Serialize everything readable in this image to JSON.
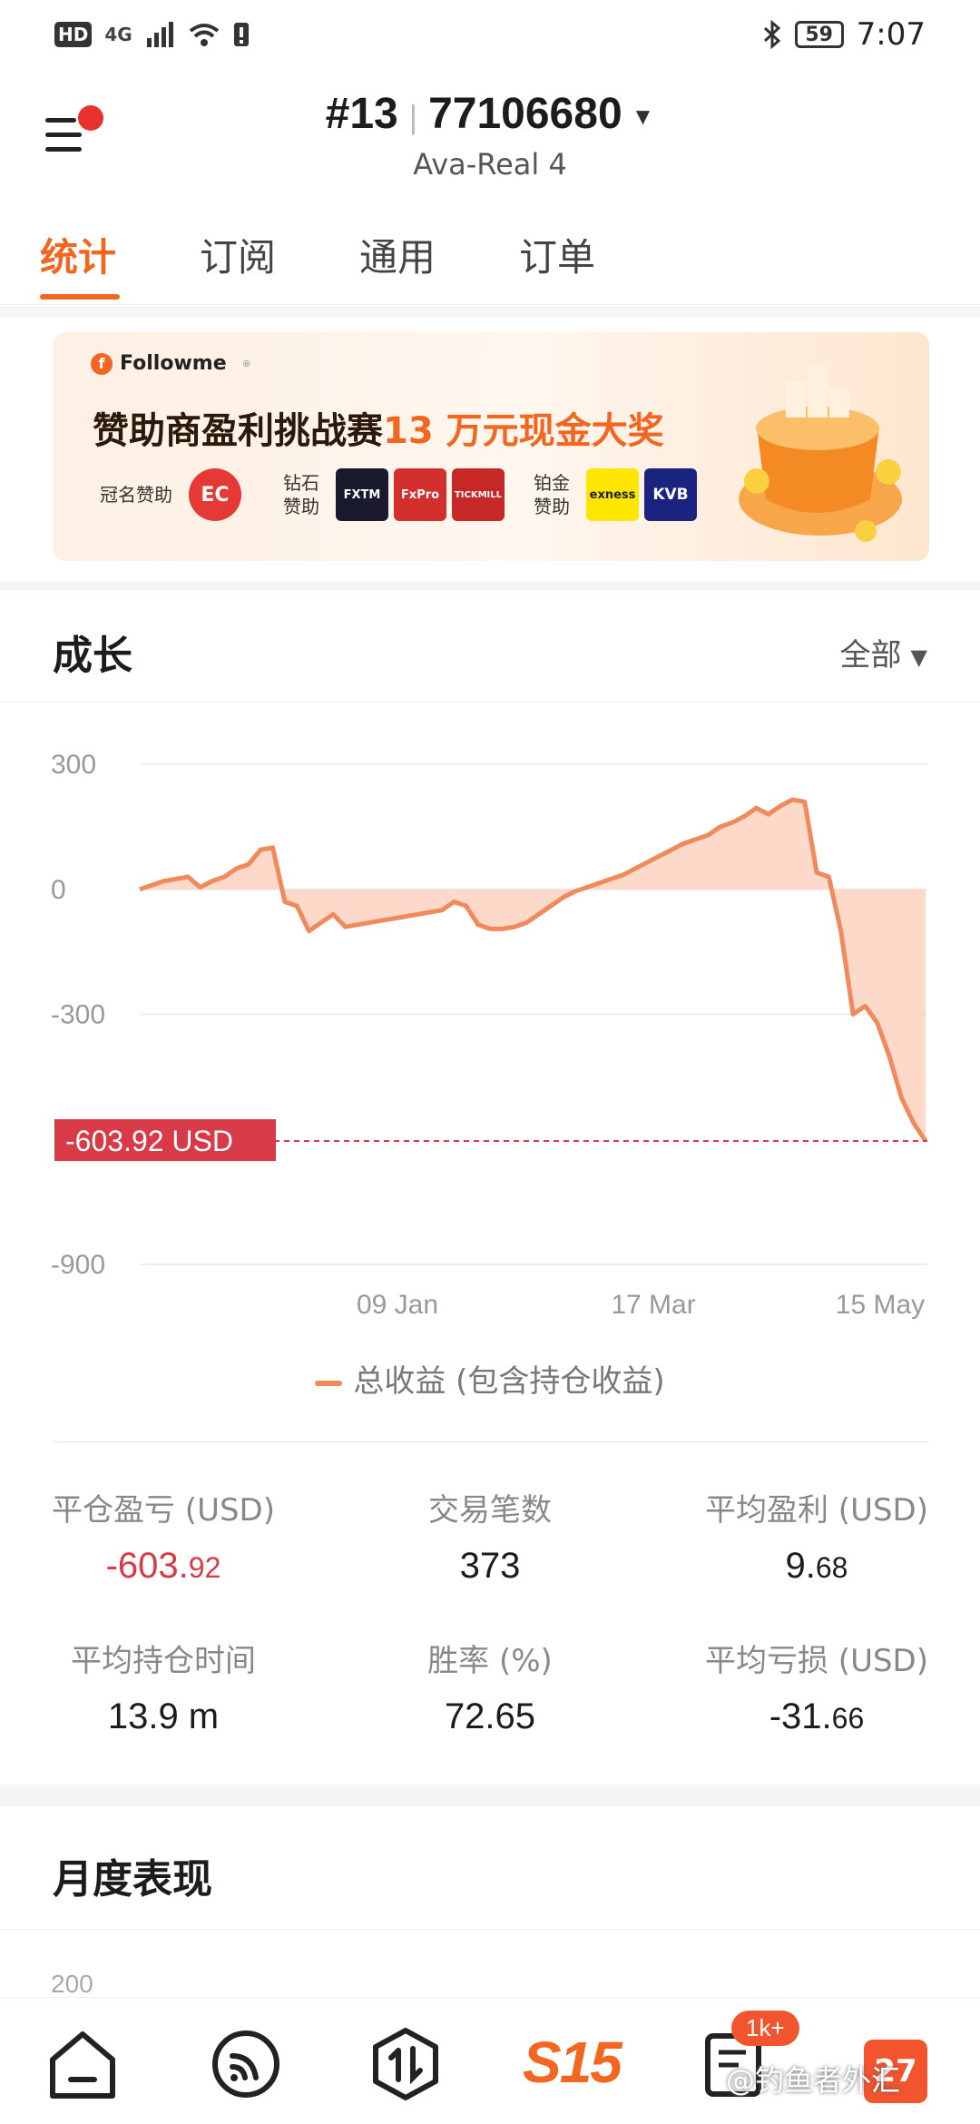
{
  "status_bar": {
    "network": "HD",
    "signal": "4G",
    "battery": "59",
    "time": "7:07"
  },
  "header": {
    "account_index": "#13",
    "account_number": "77106680",
    "account_server": "Ava-Real 4"
  },
  "tabs": [
    {
      "label": "统计",
      "active": true
    },
    {
      "label": "订阅",
      "active": false
    },
    {
      "label": "通用",
      "active": false
    },
    {
      "label": "订单",
      "active": false
    }
  ],
  "banner": {
    "brand": "Followme",
    "title_part1": "赞助商盈利挑战赛",
    "title_highlight": "13 万元现金大奖",
    "title_sponsor_label": "冠名赞助",
    "diamond_label_1": "钻石",
    "diamond_label_2": "赞助",
    "platinum_label_1": "铂金",
    "platinum_label_2": "赞助",
    "logos": [
      "EC",
      "FXTM",
      "FxPro",
      "TICKMILL",
      "exness",
      "KVB"
    ]
  },
  "growth": {
    "title": "成长",
    "range": "全部",
    "current_value_label": "-603.92 USD",
    "legend": "总收益 (包含持仓收益)"
  },
  "chart_data": {
    "type": "area",
    "ylim": [
      -900,
      300
    ],
    "yticks": [
      "300",
      "0",
      "-300",
      "-900"
    ],
    "xticks": [
      "09 Jan",
      "17 Mar",
      "15 May"
    ],
    "current_value": -603.92,
    "series": [
      {
        "values": [
          0,
          10,
          20,
          25,
          30,
          5,
          20,
          30,
          50,
          60,
          95,
          100,
          -30,
          -40,
          -100,
          -80,
          -60,
          -90,
          -85,
          -80,
          -75,
          -70,
          -65,
          -60,
          -55,
          -50,
          -30,
          -40,
          -85,
          -95,
          -95,
          -90,
          -80,
          -60,
          -40,
          -20,
          -5,
          5,
          15,
          25,
          35,
          50,
          65,
          80,
          95,
          110,
          120,
          130,
          150,
          160,
          175,
          195,
          180,
          200,
          215,
          210,
          40,
          30,
          -100,
          -300,
          -280,
          -320,
          -400,
          -500,
          -560,
          -604
        ]
      }
    ]
  },
  "stats": [
    {
      "label": "平仓盈亏 (USD)",
      "int": "-603.",
      "dec": "92",
      "negative": true
    },
    {
      "label": "交易笔数",
      "int": "373",
      "dec": "",
      "negative": false
    },
    {
      "label": "平均盈利 (USD)",
      "int": "9.",
      "dec": "68",
      "negative": false
    },
    {
      "label": "平均持仓时间",
      "int": "13.9 m",
      "dec": "",
      "negative": false
    },
    {
      "label": "胜率 (%)",
      "int": "72.65",
      "dec": "",
      "negative": false
    },
    {
      "label": "平均亏损 (USD)",
      "int": "-31.",
      "dec": "66",
      "negative": false
    }
  ],
  "monthly": {
    "title": "月度表现",
    "first_tick": "200"
  },
  "bottom_nav": {
    "center_label": "S15",
    "badge": "1k+",
    "watermark": "@钓鱼者外汇",
    "orange_box": "27"
  },
  "colors": {
    "accent": "#f2661f",
    "negative": "#d93a48",
    "line": "#f08a5d",
    "fill": "#fbd2c0"
  }
}
